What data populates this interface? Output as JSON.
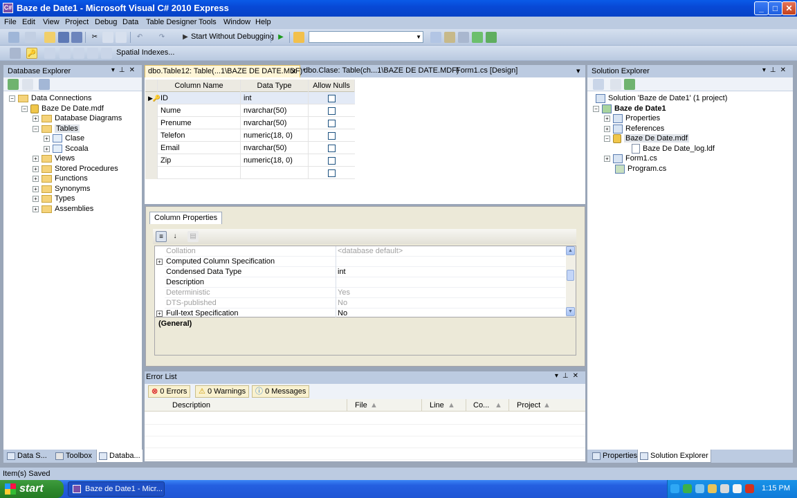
{
  "window": {
    "title": "Baze de Date1 - Microsoft Visual C# 2010 Express",
    "icon": "vs-icon",
    "min": "_",
    "max": "□",
    "close": "✕"
  },
  "menu": [
    "File",
    "Edit",
    "View",
    "Project",
    "Debug",
    "Data",
    "Table Designer",
    "Tools",
    "Window",
    "Help"
  ],
  "toolbar1": {
    "start_without_debugging": "Start Without Debugging",
    "config_combo_value": ""
  },
  "toolbar2": {
    "spatial_indexes": "Spatial Indexes..."
  },
  "database_explorer": {
    "title": "Database Explorer",
    "tree": [
      {
        "label": "Data Connections",
        "icon": "folder-icon",
        "expander": "−"
      },
      {
        "label": "Baze De Date.mdf",
        "icon": "database-icon",
        "expander": "−"
      },
      {
        "label": "Database Diagrams",
        "icon": "folder-icon",
        "expander": "+"
      },
      {
        "label": "Tables",
        "icon": "folder-icon",
        "expander": "−",
        "selected": true
      },
      {
        "label": "Clase",
        "icon": "table-icon",
        "expander": "+"
      },
      {
        "label": "Scoala",
        "icon": "table-icon",
        "expander": "+"
      },
      {
        "label": "Views",
        "icon": "folder-icon",
        "expander": "+"
      },
      {
        "label": "Stored Procedures",
        "icon": "folder-icon",
        "expander": "+"
      },
      {
        "label": "Functions",
        "icon": "folder-icon",
        "expander": "+"
      },
      {
        "label": "Synonyms",
        "icon": "folder-icon",
        "expander": "+"
      },
      {
        "label": "Types",
        "icon": "folder-icon",
        "expander": "+"
      },
      {
        "label": "Assemblies",
        "icon": "folder-icon",
        "expander": "+"
      }
    ],
    "bottom_tabs": [
      "Data S...",
      "Toolbox",
      "Databa..."
    ]
  },
  "document_tabs": [
    {
      "label": "dbo.Table12: Table(...1\\BAZE DE DATE.MDF)*",
      "active": true
    },
    {
      "label": "dbo.Clase: Table(ch...1\\BAZE DE DATE.MDF)"
    },
    {
      "label": "Form1.cs [Design]"
    }
  ],
  "table_designer": {
    "headers": [
      "Column Name",
      "Data Type",
      "Allow Nulls"
    ],
    "rows": [
      {
        "name": "ID",
        "type": "int",
        "allow_nulls": false,
        "primary_key": true
      },
      {
        "name": "Nume",
        "type": "nvarchar(50)",
        "allow_nulls": false
      },
      {
        "name": "Prenume",
        "type": "nvarchar(50)",
        "allow_nulls": false
      },
      {
        "name": "Telefon",
        "type": "numeric(18, 0)",
        "allow_nulls": false
      },
      {
        "name": "Email",
        "type": "nvarchar(50)",
        "allow_nulls": false
      },
      {
        "name": "Zip",
        "type": "numeric(18, 0)",
        "allow_nulls": false
      },
      {
        "name": "",
        "type": "",
        "allow_nulls": false
      }
    ]
  },
  "column_properties": {
    "tab": "Column Properties",
    "rows": [
      {
        "name": "Collation",
        "value": "<database default>",
        "dim": true,
        "expander": ""
      },
      {
        "name": "Computed Column Specification",
        "value": "",
        "dim": false,
        "expander": "+"
      },
      {
        "name": "Condensed Data Type",
        "value": "int",
        "dim": false,
        "expander": ""
      },
      {
        "name": "Description",
        "value": "",
        "dim": false,
        "expander": ""
      },
      {
        "name": "Deterministic",
        "value": "Yes",
        "dim": true,
        "expander": ""
      },
      {
        "name": "DTS-published",
        "value": "No",
        "dim": true,
        "expander": ""
      },
      {
        "name": "Full-text Specification",
        "value": "No",
        "dim": false,
        "expander": "+"
      }
    ],
    "description_title": "(General)"
  },
  "error_list": {
    "title": "Error List",
    "errors": "0 Errors",
    "warnings": "0 Warnings",
    "messages": "0 Messages",
    "columns": [
      "Description",
      "File",
      "Line",
      "Co...",
      "Project"
    ]
  },
  "solution_explorer": {
    "title": "Solution Explorer",
    "tree": [
      {
        "label": "Solution 'Baze de Date1' (1 project)",
        "icon": "solution-icon",
        "expander": ""
      },
      {
        "label": "Baze de Date1",
        "icon": "project-icon",
        "expander": "−",
        "bold": true
      },
      {
        "label": "Properties",
        "icon": "properties-icon",
        "expander": "+"
      },
      {
        "label": "References",
        "icon": "references-icon",
        "expander": "+"
      },
      {
        "label": "Baze De Date.mdf",
        "icon": "database-icon",
        "expander": "−",
        "selected": true
      },
      {
        "label": "Baze De Date_log.ldf",
        "icon": "file-icon",
        "expander": ""
      },
      {
        "label": "Form1.cs",
        "icon": "form-icon",
        "expander": "+"
      },
      {
        "label": "Program.cs",
        "icon": "csharp-file-icon",
        "expander": ""
      }
    ],
    "bottom_tabs": [
      "Properties",
      "Solution Explorer"
    ]
  },
  "status": {
    "text": "Item(s) Saved"
  },
  "taskbar": {
    "start": "start",
    "item": "Baze de Date1 - Micr...",
    "clock": "1:15 PM"
  }
}
